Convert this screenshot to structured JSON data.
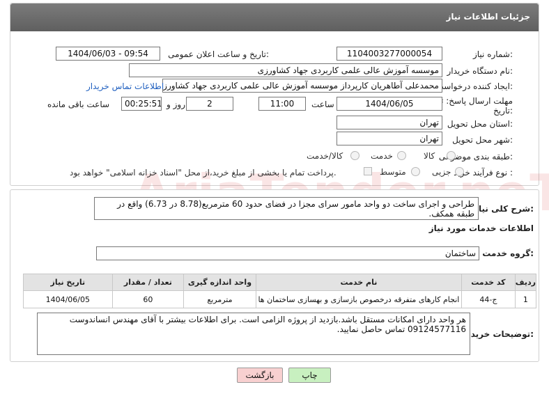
{
  "header": {
    "title": "جزئیات اطلاعات نیاز"
  },
  "fields": {
    "need_number_label": "شماره نیاز:",
    "need_number": "1104003277000054",
    "announce_label": "تاریخ و ساعت اعلان عمومی:",
    "announce_value": "1404/06/03 - 09:54",
    "buyer_org_label": "نام دستگاه خریدار:",
    "buyer_org": "موسسه آموزش عالی علمی کاربردی جهاد کشاورزی",
    "requester_label": "ایجاد کننده درخواست:",
    "requester": "محمدعلی آطاهریان کارپرداز موسسه آموزش عالی علمی کاربردی جهاد کشاورزی",
    "contact_link": "اطلاعات تماس خریدار",
    "deadline_label_1": "مهلت ارسال پاسخ: تا",
    "deadline_label_2": "تاریخ:",
    "deadline_date": "1404/06/05",
    "time_label": "ساعت",
    "deadline_time": "11:00",
    "days_value": "2",
    "days_label": "روز و",
    "remaining_time": "00:25:51",
    "remaining_label": "ساعت باقی مانده",
    "province_label": "استان محل تحویل:",
    "province": "تهران",
    "city_label": "شهر محل تحویل:",
    "city": "تهران",
    "category_label": "طبقه بندی موضوعی:",
    "category_options": [
      "کالا",
      "خدمت",
      "کالا/خدمت"
    ],
    "purchase_type_label": "نوع فرآیند خرید :",
    "purchase_options": [
      "جزیی",
      "متوسط"
    ],
    "payment_note": "پرداخت تمام یا بخشی از مبلغ خرید،از محل \"اسناد خزانه اسلامی\" خواهد بود."
  },
  "details": {
    "description_label": "شرح کلی نیاز:",
    "description": "طراحی و اجرای ساخت دو واحد مامور سرای مجزا در فضای حدود 60 مترمربع(8.78 در 6.73) واقع در طبقه همکف.",
    "services_title": "اطلاعات خدمات مورد نیاز",
    "service_group_label": "گروه خدمت:",
    "service_group": "ساختمان",
    "table": {
      "headers": [
        "ردیف",
        "کد خدمت",
        "نام خدمت",
        "واحد اندازه گیری",
        "تعداد / مقدار",
        "تاریخ نیاز"
      ],
      "rows": [
        [
          "1",
          "ج-44",
          "انجام کارهای متفرقه درخصوص بازسازی و بهسازی ساختمان ها",
          "مترمربع",
          "60",
          "1404/06/05"
        ]
      ]
    },
    "buyer_notes_label": "توضیحات خریدار:",
    "buyer_notes": "هر واحد دارای امکانات مستقل باشد.بازدید از پروژه الزامی است. برای اطلاعات بیشتر با آقای مهندس انساندوست 09124577116 تماس حاصل نمایید."
  },
  "buttons": {
    "print": "چاپ",
    "back": "بازگشت"
  },
  "watermark": "AriaTender.neT",
  "colors": {
    "header_bg": "#6b6b6b",
    "link": "#1f5fbf",
    "print_btn": "#c8f0c0",
    "back_btn": "#f8d0d0"
  }
}
